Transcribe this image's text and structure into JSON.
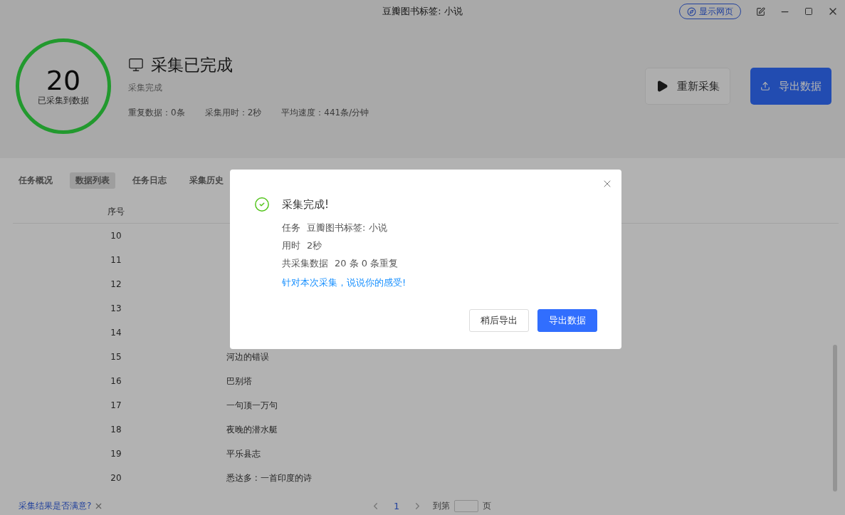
{
  "window": {
    "title": "豆瓣图书标签: 小说",
    "show_webpage_button": "显示网页"
  },
  "summary": {
    "count": "20",
    "count_label": "已采集到数据",
    "title": "采集已完成",
    "subtitle": "采集完成",
    "stats": [
      "重复数据：0条",
      "采集用时：2秒",
      "平均速度：441条/分钟"
    ]
  },
  "actions": [
    {
      "kind": "secondary",
      "label": "重新采集"
    },
    {
      "kind": "primary",
      "label": "导出数据"
    }
  ],
  "tabs": [
    {
      "label": "任务概况",
      "selected": false
    },
    {
      "label": "数据列表",
      "selected": true
    },
    {
      "label": "任务日志",
      "selected": false
    },
    {
      "label": "采集历史",
      "selected": false
    }
  ],
  "table": {
    "columns": [
      "序号"
    ],
    "rows": [
      {
        "index": "10"
      },
      {
        "index": "11"
      },
      {
        "index": "12"
      },
      {
        "index": "13"
      },
      {
        "index": "14"
      },
      {
        "index": "15",
        "title": "河边的错误"
      },
      {
        "index": "16",
        "title": "巴别塔"
      },
      {
        "index": "17",
        "title": "一句顶一万句"
      },
      {
        "index": "18",
        "title": "夜晚的潜水艇"
      },
      {
        "index": "19",
        "title": "平乐县志"
      },
      {
        "index": "20",
        "title": "悉达多 : 一首印度的诗"
      }
    ]
  },
  "footer": {
    "feedback_link": "采集结果是否满意?",
    "pages": [
      {
        "label": "1",
        "selected": true
      }
    ],
    "goto_label": "到第",
    "goto_suffix": "页"
  },
  "dialog": {
    "title": "采集完成!",
    "details": [
      {
        "label": "任务",
        "value": "豆瓣图书标签: 小说"
      },
      {
        "label": "用时",
        "value": "2秒"
      },
      {
        "label": "共采集数据",
        "value": "20 条 0 条重复"
      }
    ],
    "link": "针对本次采集，说说你的感受!",
    "buttons": [
      {
        "kind": "secondary",
        "label": "稍后导出"
      },
      {
        "kind": "primary",
        "label": "导出数据"
      }
    ]
  }
}
